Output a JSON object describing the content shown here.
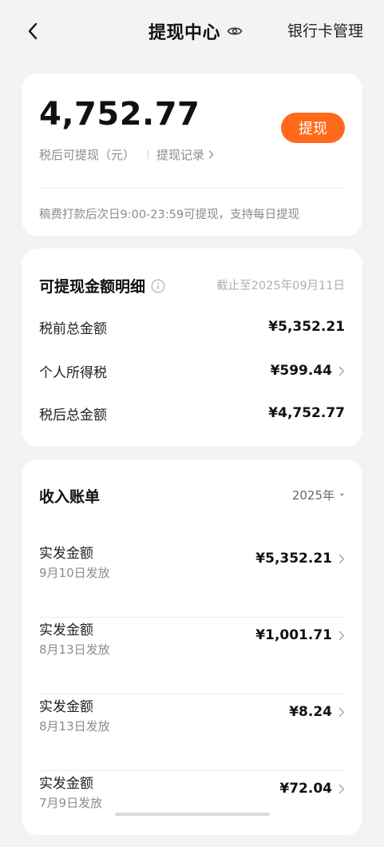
{
  "header": {
    "title": "提现中心",
    "bank_card_manage": "银行卡管理"
  },
  "balance": {
    "amount": "4,752.77",
    "caption": "税后可提现（元）",
    "withdraw_button": "提现",
    "records_link": "提现记录",
    "notice": "稿费打款后次日9:00-23:59可提现，支持每日提现"
  },
  "detail": {
    "title": "可提现金额明细",
    "as_of": "截止至2025年09月11日",
    "rows": [
      {
        "label": "税前总金额",
        "value": "¥5,352.21"
      },
      {
        "label": "个人所得税",
        "value": "¥599.44"
      },
      {
        "label": "税后总金额",
        "value": "¥4,752.77"
      }
    ]
  },
  "income": {
    "title": "收入账单",
    "year": "2025年",
    "bills": [
      {
        "label": "实发金额",
        "date": "9月10日发放",
        "amount": "¥5,352.21"
      },
      {
        "label": "实发金额",
        "date": "8月13日发放",
        "amount": "¥1,001.71"
      },
      {
        "label": "实发金额",
        "date": "8月13日发放",
        "amount": "¥8.24"
      },
      {
        "label": "实发金额",
        "date": "7月9日发放",
        "amount": "¥72.04"
      }
    ]
  },
  "colors": {
    "accent": "#ff6a1a",
    "background": "#f3f3f5",
    "muted_text": "#8c8c8c"
  },
  "icons": {
    "back": "chevron-left-icon",
    "visibility": "eye-icon",
    "info": "info-circle-icon",
    "row_arrow": "chevron-right-icon",
    "year_dropdown": "caret-down-icon"
  }
}
